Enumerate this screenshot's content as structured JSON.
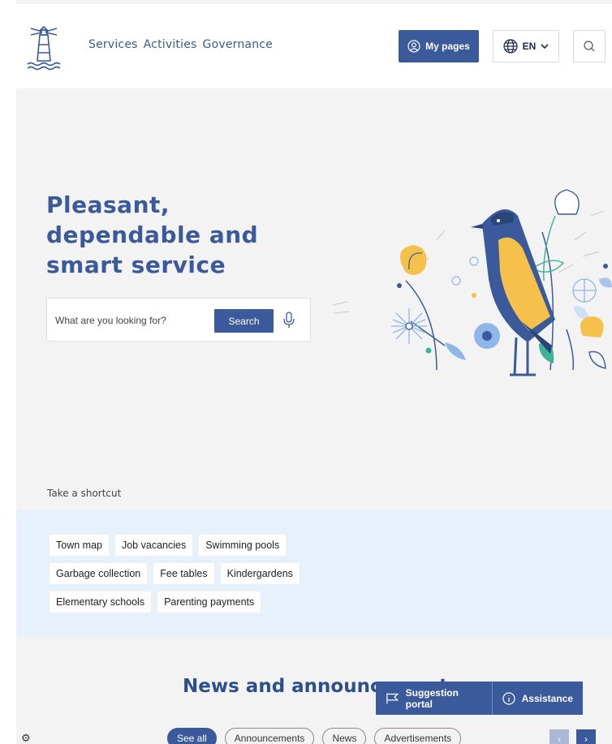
{
  "header": {
    "nav": [
      "Services",
      "Activities",
      "Governance"
    ],
    "my_pages_label": "My pages",
    "lang_label": "EN"
  },
  "hero": {
    "title_lines": [
      "Pleasant,",
      "dependable and",
      "smart service"
    ],
    "search_placeholder": "What are you looking for?",
    "search_button": "Search"
  },
  "shortcuts": {
    "title": "Take a shortcut",
    "rows": [
      [
        "Town map",
        "Job vacancies",
        "Swimming pools"
      ],
      [
        "Garbage collection",
        "Fee tables",
        "Kindergardens"
      ],
      [
        "Elementary schools",
        "Parenting payments"
      ]
    ]
  },
  "news": {
    "title": "News and announcements",
    "filters": [
      "See all",
      "Announcements",
      "News",
      "Advertisements"
    ]
  },
  "floating": {
    "suggestion_label": "Suggestion portal",
    "assistance_label": "Assistance"
  },
  "colors": {
    "brand": "#3a5a9b",
    "accent_yellow": "#f6c14b",
    "band": "#e6f1fb"
  },
  "icons": [
    "lighthouse-logo",
    "user-icon",
    "globe-icon",
    "chevron-down-icon",
    "search-icon",
    "microphone-icon",
    "flag-icon",
    "info-icon",
    "gear-icon",
    "chevron-left-icon",
    "chevron-right-icon"
  ]
}
